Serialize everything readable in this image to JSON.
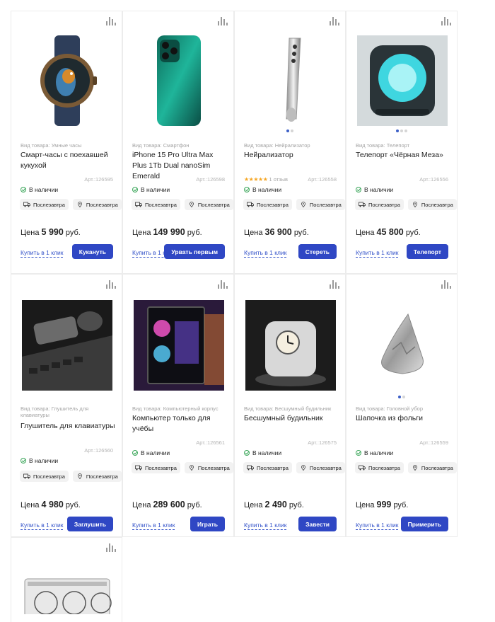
{
  "icons": {
    "compare": "bar-chart-icon",
    "in_stock": "check-circle-icon",
    "delivery": "truck-icon",
    "pickup": "location-pin-icon"
  },
  "colors": {
    "accent": "#2f47c4",
    "link": "#3150c8",
    "stock": "#3aa659",
    "star": "#f6a623"
  },
  "products": [
    {
      "type": "Вид товара: Умные часы",
      "name": "Смарт-часы с поехавшей кукухой",
      "art": "Арт.:126595",
      "stock": "В наличии",
      "delivery": "Послезавтра",
      "pickup": "Послезавтра",
      "price_label": "Цена",
      "price": "5 990",
      "currency": "руб.",
      "one_click": "Купить в 1 клик",
      "button": "Кукануть",
      "image": "smart-watch-image"
    },
    {
      "type": "Вид товара: Смартфон",
      "name": "iPhone 15 Pro Ultra Max Plus 1Tb Dual nanoSim Emerald",
      "art": "Арт.:126598",
      "stock": "В наличии",
      "delivery": "Послезавтра",
      "pickup": "Послезавтра",
      "price_label": "Цена",
      "price": "149 990",
      "currency": "руб.",
      "one_click": "Купить в 1 клик",
      "button": "Урвать первым",
      "image": "smartphone-image"
    },
    {
      "type": "Вид товара: Нейрализатор",
      "name": "Нейрализатор",
      "rating_stars": "★★★★★",
      "rating_count": "1 отзыв",
      "rating": 5,
      "art": "Арт.:126558",
      "stock": "В наличии",
      "delivery": "Послезавтра",
      "pickup": "Послезавтра",
      "price_label": "Цена",
      "price": "36 900",
      "currency": "руб.",
      "one_click": "Купить в 1 клик",
      "button": "Стереть",
      "image": "neuralyzer-image"
    },
    {
      "type": "Вид товара: Телепорт",
      "name": "Телепорт «Чёрная Меза»",
      "art": "Арт.:126556",
      "stock": "В наличии",
      "delivery": "Послезавтра",
      "pickup": "Послезавтра",
      "price_label": "Цена",
      "price": "45 800",
      "currency": "руб.",
      "one_click": "Купить в 1 клик",
      "button": "Телепорт",
      "image": "teleport-image"
    },
    {
      "type": "Вид товара: Глушитель для клавиатуры",
      "name": "Глушитель для клавиатуры",
      "art": "Арт.:126560",
      "stock": "В наличии",
      "delivery": "Послезавтра",
      "pickup": "Послезавтра",
      "price_label": "Цена",
      "price": "4 980",
      "currency": "руб.",
      "one_click": "Купить в 1 клик",
      "button": "Заглушить",
      "image": "keyboard-silencer-image"
    },
    {
      "type": "Вид товара: Компьютерный корпус",
      "name": "Компьютер только для учёбы",
      "art": "Арт.:126561",
      "stock": "В наличии",
      "delivery": "Послезавтра",
      "pickup": "Послезавтра",
      "price_label": "Цена",
      "price": "289 600",
      "currency": "руб.",
      "one_click": "Купить в 1 клик",
      "button": "Играть",
      "image": "gaming-pc-image"
    },
    {
      "type": "Вид товара: Бесшумный будильник",
      "name": "Бесшумный будильник",
      "art": "Арт.:126575",
      "stock": "В наличии",
      "delivery": "Послезавтра",
      "pickup": "Послезавтра",
      "price_label": "Цена",
      "price": "2 490",
      "currency": "руб.",
      "one_click": "Купить в 1 клик",
      "button": "Завести",
      "image": "alarm-clock-image"
    },
    {
      "type": "Вид товара: Головной убор",
      "name": "Шапочка из фольги",
      "art": "Арт.:126559",
      "stock": "В наличии",
      "delivery": "Послезавтра",
      "pickup": "Послезавтра",
      "price_label": "Цена",
      "price": "999",
      "currency": "руб.",
      "one_click": "Купить в 1 клик",
      "button": "Примерить",
      "image": "foil-hat-image"
    },
    {
      "image": "graphics-card-image"
    }
  ]
}
